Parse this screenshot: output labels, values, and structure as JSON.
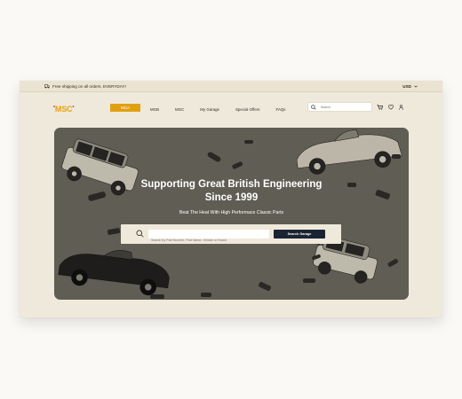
{
  "topbar": {
    "shipping_text": "Free shipping on all orders, EVERYDAY!",
    "currency": "USD"
  },
  "brand": {
    "logo_text": "MSC"
  },
  "nav": {
    "items": [
      {
        "label": "MGA",
        "active": true
      },
      {
        "label": "MGB",
        "active": false
      },
      {
        "label": "MGC",
        "active": false
      },
      {
        "label": "My Garage",
        "active": false
      },
      {
        "label": "Special Offers",
        "active": false
      },
      {
        "label": "FAQs",
        "active": false
      }
    ],
    "search_placeholder": "Search"
  },
  "hero": {
    "title_line1": "Supporting Great British Engineering",
    "title_line2": "Since 1999",
    "subtitle": "Beat The Heat With High Performace Classic Parts",
    "search_placeholder": "Search by Part Number, Part Name, Vehicle or Brand",
    "search_button": "Search Garage"
  },
  "colors": {
    "accent": "#e0a012",
    "dark": "#1b2432",
    "cream": "#efe9db"
  },
  "icons": [
    "truck-icon",
    "chevron-down-icon",
    "search-icon",
    "cart-icon",
    "heart-icon",
    "user-icon"
  ]
}
